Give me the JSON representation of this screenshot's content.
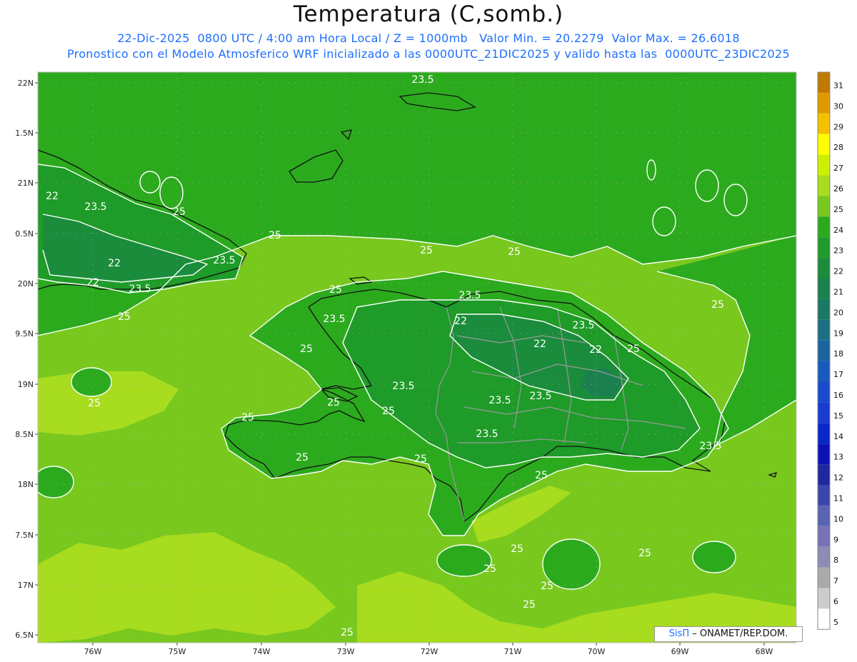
{
  "title": "Temperatura (C,somb.)",
  "subtitle_line1": "22-Dic-2025  0800 UTC / 4:00 am Hora Local / Z = 1000mb   Valor Min. = 20.2279  Valor Max. = 26.6018",
  "subtitle_line2": "Pronostico con el Modelo Atmosferico WRF inicializado a las 0000UTC_21DIC2025 y valido hasta las  0000UTC_23DIC2025",
  "lat_labels": [
    "22N",
    "1.5N",
    "21N",
    "0.5N",
    "20N",
    "9.5N",
    "19N",
    "8.5N",
    "18N",
    "7.5N",
    "17N",
    "6.5N"
  ],
  "lon_labels": [
    "76W",
    "75W",
    "74W",
    "73W",
    "72W",
    "71W",
    "70W",
    "69W",
    "68W"
  ],
  "colorbar": {
    "levels": [
      "31",
      "30",
      "29",
      "28",
      "27",
      "26",
      "25",
      "24",
      "23",
      "22",
      "21",
      "20",
      "19",
      "18",
      "17",
      "16",
      "15",
      "14",
      "13",
      "12",
      "11",
      "10",
      "9",
      "8",
      "7",
      "6",
      "5"
    ],
    "colors": [
      "#c07a00",
      "#e09a00",
      "#f5c000",
      "#ffff00",
      "#cdf000",
      "#a8dc1e",
      "#78c81e",
      "#2caa1e",
      "#1e9b28",
      "#1a8c3c",
      "#1a8050",
      "#1a7864",
      "#1a7082",
      "#1a64a0",
      "#1a5abe",
      "#1a4bcd",
      "#1a3cd2",
      "#0a28c8",
      "#0a14b4",
      "#1e28a0",
      "#3c46aa",
      "#5a64b4",
      "#7873b4",
      "#8c8cb4",
      "#aaaaaa",
      "#cccccc",
      "#ffffff"
    ]
  },
  "contour_labels": [
    "23.5",
    "22",
    "23.5",
    "25",
    "25",
    "25",
    "23.5",
    "22",
    "23.5",
    "22",
    "25",
    "25",
    "25",
    "23.5",
    "25",
    "23.5",
    "22",
    "25",
    "22",
    "23.5",
    "22",
    "25",
    "23.5",
    "25",
    "25",
    "25",
    "23.5",
    "23.5",
    "25",
    "23.5",
    "25",
    "25",
    "23.5",
    "25",
    "25",
    "25",
    "25",
    "25",
    "25",
    "25"
  ],
  "credit": {
    "brand": "SisΠ",
    "text": " – ONAMET/REP.DOM."
  }
}
